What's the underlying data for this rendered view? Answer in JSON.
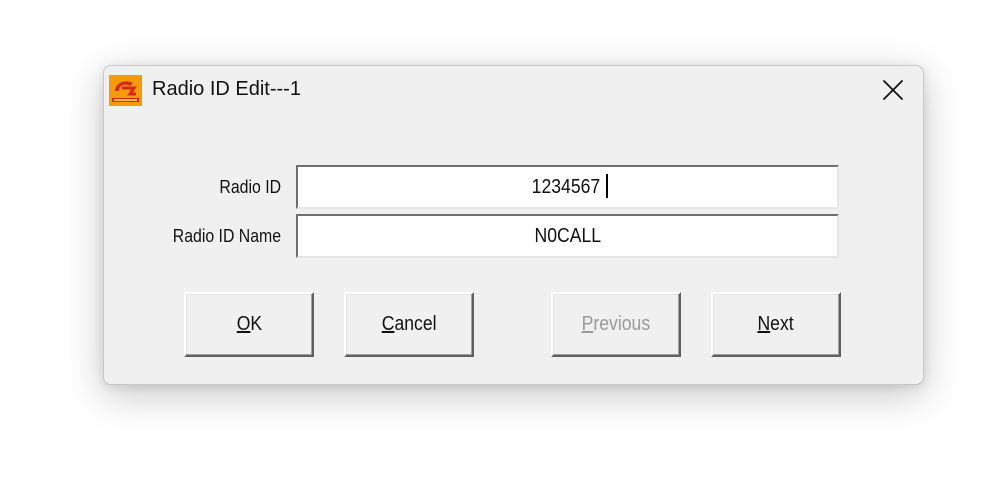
{
  "dialog": {
    "title": "Radio ID Edit---1",
    "icon": "app-logo-icon",
    "close_icon": "close-icon"
  },
  "fields": {
    "radio_id": {
      "label": "Radio ID",
      "value": "1234567"
    },
    "radio_id_name": {
      "label": "Radio ID Name",
      "value": "N0CALL"
    }
  },
  "buttons": {
    "ok": {
      "mnemonic": "O",
      "rest": "K",
      "enabled": true
    },
    "cancel": {
      "mnemonic": "C",
      "rest": "ancel",
      "enabled": true
    },
    "previous": {
      "mnemonic": "P",
      "rest": "revious",
      "enabled": false
    },
    "next": {
      "mnemonic": "N",
      "rest": "ext",
      "enabled": true
    }
  },
  "colors": {
    "dialog_background": "#f0f0f0",
    "disabled_text": "#9a9a9a",
    "icon_orange": "#f59a0a",
    "icon_red": "#d8281c"
  }
}
